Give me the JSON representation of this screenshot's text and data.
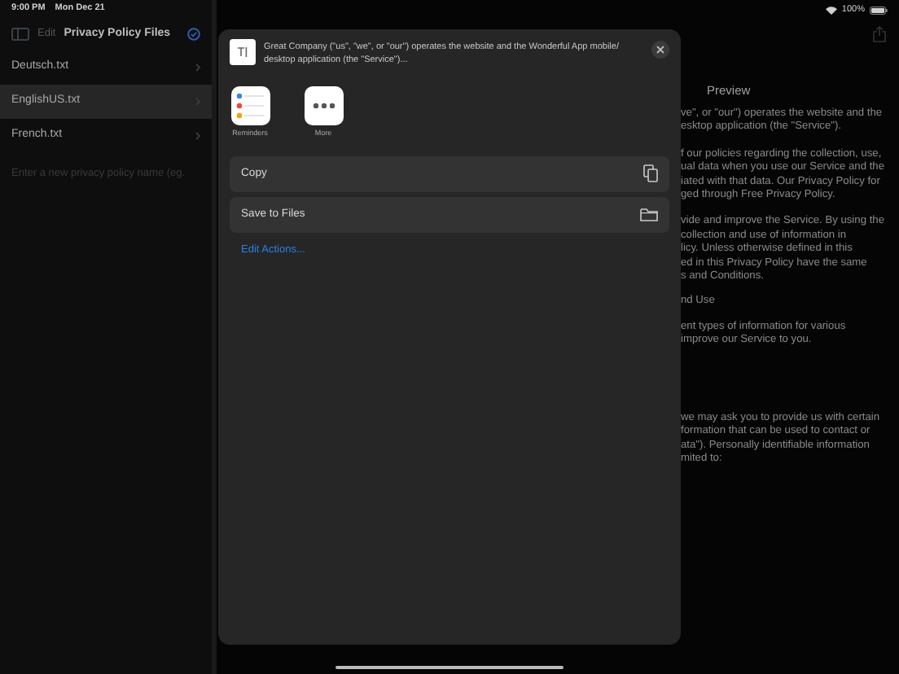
{
  "status_bar": {
    "time": "9:00 PM",
    "date": "Mon Dec 21",
    "battery": "100%"
  },
  "sidebar": {
    "edit": "Edit",
    "title": "Privacy Policy Files",
    "items": [
      {
        "label": "Deutsch.txt",
        "selected": false
      },
      {
        "label": "EnglishUS.txt",
        "selected": true
      },
      {
        "label": "French.txt",
        "selected": false
      }
    ],
    "new_name_field": {
      "placeholder": "Enter a new privacy policy name (eg."
    }
  },
  "preview": {
    "title": "Preview",
    "paragraphs": [
      {
        "lines": [
          "ve\", or \"our\") operates the website and the",
          "esktop application (the \"Service\")."
        ]
      },
      {
        "lines": [
          "f our policies regarding the collection, use,",
          "ual data when you use our Service and the",
          "iated with that data. Our Privacy Policy for",
          "ged through Free Privacy Policy."
        ]
      },
      {
        "lines": [
          "vide and improve the Service. By using the",
          "collection and use of information in",
          "licy. Unless otherwise defined in this",
          "ed in this Privacy Policy have the same",
          "s and Conditions."
        ]
      },
      {
        "lines": [
          "nd Use"
        ]
      },
      {
        "lines": [
          "ent types of information for various",
          "improve our Service to you."
        ]
      },
      {
        "lines": [
          "we may ask you to provide us with certain",
          "formation that can be used to contact or",
          "ata\"). Personally identifiable information",
          "mited to:"
        ]
      }
    ]
  },
  "share_sheet": {
    "document_preview": "Great Company (\"us\", \"we\", or \"our\") operates the website and the Wonderful App mobile/ desktop application (the \"Service\")...",
    "apps": [
      {
        "kind": "reminders",
        "label": "Reminders"
      },
      {
        "kind": "more",
        "label": "More"
      }
    ],
    "actions": [
      {
        "kind": "copy",
        "label": "Copy"
      },
      {
        "kind": "folder",
        "label": "Save to Files"
      }
    ],
    "edit_actions": "Edit Actions..."
  }
}
